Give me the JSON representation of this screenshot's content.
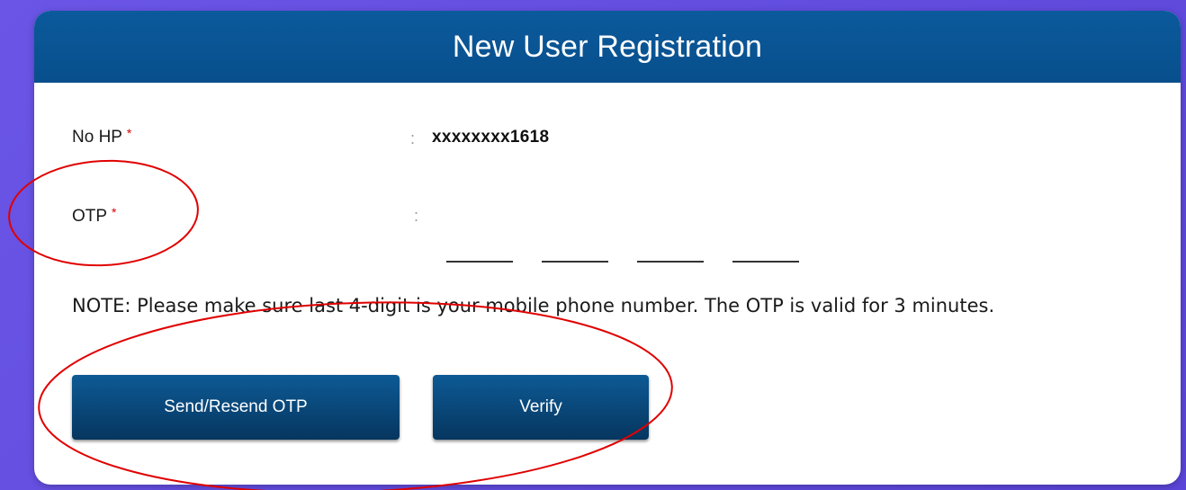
{
  "form": {
    "title": "New User Registration",
    "phone_label": "No HP",
    "required_mark": "*",
    "colon": ":",
    "phone_value": "xxxxxxxx1618",
    "otp_label": "OTP",
    "otp_digits": [
      "",
      "",
      "",
      ""
    ],
    "note": "NOTE: Please make sure last 4-digit is your mobile phone number. The OTP is valid for 3 minutes.",
    "send_button": "Send/Resend OTP",
    "verify_button": "Verify"
  },
  "colors": {
    "header": "#0b5a9c",
    "button": "#06365f",
    "required": "#d60000",
    "annotation": "#e00000",
    "background": "#6a55e6"
  }
}
